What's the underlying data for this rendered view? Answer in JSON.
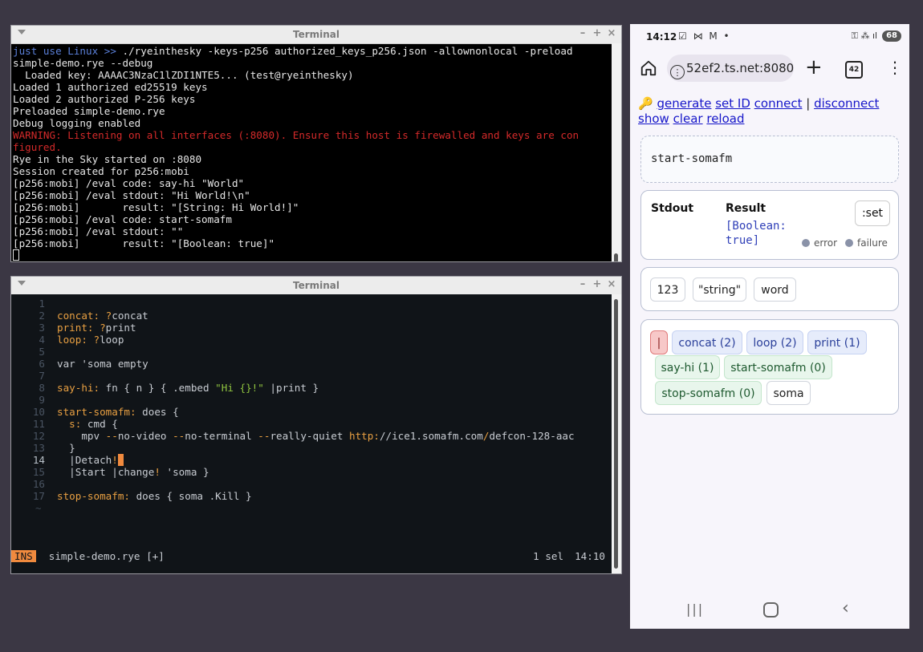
{
  "terminal_top": {
    "title": "Terminal",
    "lines": [
      {
        "segments": [
          {
            "t": "just use Linux >> ",
            "c": "blue"
          },
          {
            "t": "./ryeinthesky -keys-p256 authorized_keys_p256.json -allownonlocal -preload",
            "c": ""
          }
        ]
      },
      {
        "segments": [
          {
            "t": "simple-demo.rye --debug",
            "c": ""
          }
        ]
      },
      {
        "segments": [
          {
            "t": "  Loaded key: AAAAC3NzaC1lZDI1NTE5... (test@ryeinthesky)",
            "c": ""
          }
        ]
      },
      {
        "segments": [
          {
            "t": "Loaded 1 authorized ed25519 keys",
            "c": ""
          }
        ]
      },
      {
        "segments": [
          {
            "t": "Loaded 2 authorized P-256 keys",
            "c": ""
          }
        ]
      },
      {
        "segments": [
          {
            "t": "Preloaded simple-demo.rye",
            "c": ""
          }
        ]
      },
      {
        "segments": [
          {
            "t": "Debug logging enabled",
            "c": ""
          }
        ]
      },
      {
        "segments": [
          {
            "t": "WARNING: Listening on all interfaces (:8080). Ensure this host is firewalled and keys are con",
            "c": "red"
          }
        ]
      },
      {
        "segments": [
          {
            "t": "figured.",
            "c": "red"
          }
        ]
      },
      {
        "segments": [
          {
            "t": "Rye in the Sky started on :8080",
            "c": ""
          }
        ]
      },
      {
        "segments": [
          {
            "t": "Session created for p256:mobi",
            "c": ""
          }
        ]
      },
      {
        "segments": [
          {
            "t": "[p256:mobi] /eval code: say-hi \"World\"",
            "c": ""
          }
        ]
      },
      {
        "segments": [
          {
            "t": "[p256:mobi] /eval stdout: \"Hi World!\\n\"",
            "c": ""
          }
        ]
      },
      {
        "segments": [
          {
            "t": "[p256:mobi]       result: \"[String: Hi World!]\"",
            "c": ""
          }
        ]
      },
      {
        "segments": [
          {
            "t": "[p256:mobi] /eval code: start-somafm",
            "c": ""
          }
        ]
      },
      {
        "segments": [
          {
            "t": "[p256:mobi] /eval stdout: \"\"",
            "c": ""
          }
        ]
      },
      {
        "segments": [
          {
            "t": "[p256:mobi]       result: \"[Boolean: true]\"",
            "c": ""
          }
        ]
      }
    ]
  },
  "terminal_editor": {
    "title": "Terminal",
    "current_line": 14,
    "lines": [
      {
        "n": "1",
        "segments": []
      },
      {
        "n": "2",
        "segments": [
          {
            "t": "concat: ",
            "c": "k"
          },
          {
            "t": "?",
            "c": "k"
          },
          {
            "t": "concat",
            "c": ""
          }
        ]
      },
      {
        "n": "3",
        "segments": [
          {
            "t": "print: ",
            "c": "k"
          },
          {
            "t": "?",
            "c": "k"
          },
          {
            "t": "print",
            "c": ""
          }
        ]
      },
      {
        "n": "4",
        "segments": [
          {
            "t": "loop: ",
            "c": "k"
          },
          {
            "t": "?",
            "c": "k"
          },
          {
            "t": "loop",
            "c": ""
          }
        ]
      },
      {
        "n": "5",
        "segments": []
      },
      {
        "n": "6",
        "segments": [
          {
            "t": "var 'soma empty",
            "c": ""
          }
        ]
      },
      {
        "n": "7",
        "segments": []
      },
      {
        "n": "8",
        "segments": [
          {
            "t": "say-hi: ",
            "c": "k"
          },
          {
            "t": "fn { n } { .embed ",
            "c": ""
          },
          {
            "t": "\"Hi {}!\"",
            "c": "s"
          },
          {
            "t": " |print }",
            "c": ""
          }
        ]
      },
      {
        "n": "9",
        "segments": []
      },
      {
        "n": "10",
        "segments": [
          {
            "t": "start-somafm: ",
            "c": "k"
          },
          {
            "t": "does {",
            "c": ""
          }
        ]
      },
      {
        "n": "11",
        "segments": [
          {
            "t": "  s: ",
            "c": "k"
          },
          {
            "t": "cmd {",
            "c": ""
          }
        ]
      },
      {
        "n": "12",
        "segments": [
          {
            "t": "    mpv ",
            "c": ""
          },
          {
            "t": "--",
            "c": "k"
          },
          {
            "t": "no-video ",
            "c": ""
          },
          {
            "t": "--",
            "c": "k"
          },
          {
            "t": "no-terminal ",
            "c": ""
          },
          {
            "t": "--",
            "c": "k"
          },
          {
            "t": "really-quiet ",
            "c": ""
          },
          {
            "t": "http:",
            "c": "k"
          },
          {
            "t": "//ice1.somafm.com",
            "c": ""
          },
          {
            "t": "/",
            "c": "k"
          },
          {
            "t": "defcon-128-aac",
            "c": ""
          }
        ]
      },
      {
        "n": "13",
        "segments": [
          {
            "t": "  }",
            "c": ""
          }
        ]
      },
      {
        "n": "14",
        "segments": [
          {
            "t": "  |Detach",
            "c": ""
          },
          {
            "t": "!",
            "c": "k"
          },
          {
            "t": " ",
            "c": "cursor"
          }
        ]
      },
      {
        "n": "15",
        "segments": [
          {
            "t": "  |Start |change",
            "c": ""
          },
          {
            "t": "!",
            "c": "k"
          },
          {
            "t": " 'soma }",
            "c": ""
          }
        ]
      },
      {
        "n": "16",
        "segments": []
      },
      {
        "n": "17",
        "segments": [
          {
            "t": "stop-somafm: ",
            "c": "k"
          },
          {
            "t": "does { soma .Kill }",
            "c": ""
          }
        ]
      }
    ],
    "tilde": "~",
    "status": {
      "mode": "INS",
      "file": "simple-demo.rye [+]",
      "sel": "1 sel",
      "pos": "14:10"
    }
  },
  "phone": {
    "status_time": "14:12",
    "status_icons": "☑ ⋈ M •",
    "status_right": "⚿ ⁂ ıl",
    "battery": "68",
    "url": "52ef2.ts.net:8080",
    "tab_count": "42",
    "key_icon": "🔑",
    "links": [
      "generate",
      "set ID",
      "connect",
      "disconnect",
      "show",
      "clear",
      "reload"
    ],
    "separator": "|",
    "input_value": "start-somafm",
    "result": {
      "stdout_label": "Stdout",
      "result_label": "Result",
      "value_line1": "[Boolean:",
      "value_line2": "true]",
      "set_label": ":set",
      "error_label": "error",
      "failure_label": "failure"
    },
    "literal_chips": [
      "123",
      "\"string\"",
      "word"
    ],
    "word_chips": [
      {
        "label": "|",
        "kind": "red"
      },
      {
        "label": "concat (2)",
        "kind": "blue"
      },
      {
        "label": "loop (2)",
        "kind": "blue"
      },
      {
        "label": "print (1)",
        "kind": "blue"
      },
      {
        "label": "say-hi (1)",
        "kind": "green"
      },
      {
        "label": "start-somafm (0)",
        "kind": "green"
      },
      {
        "label": "stop-somafm (0)",
        "kind": "green"
      },
      {
        "label": "soma",
        "kind": "plain"
      }
    ],
    "nav": {
      "recent": "|||",
      "back": "‹"
    }
  }
}
